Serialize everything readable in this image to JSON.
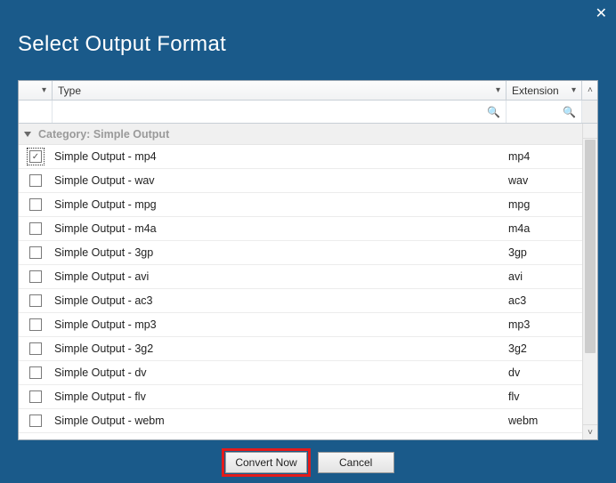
{
  "window": {
    "title": "Select Output Format"
  },
  "columns": {
    "type": "Type",
    "extension": "Extension"
  },
  "group": {
    "prefix": "Category:",
    "name": "Simple Output",
    "full": "Category:  Simple Output"
  },
  "rows": [
    {
      "type": "Simple Output - mp4",
      "ext": "mp4",
      "checked": true,
      "focused": true
    },
    {
      "type": "Simple Output - wav",
      "ext": "wav",
      "checked": false,
      "focused": false
    },
    {
      "type": "Simple Output - mpg",
      "ext": "mpg",
      "checked": false,
      "focused": false
    },
    {
      "type": "Simple Output - m4a",
      "ext": "m4a",
      "checked": false,
      "focused": false
    },
    {
      "type": "Simple Output - 3gp",
      "ext": "3gp",
      "checked": false,
      "focused": false
    },
    {
      "type": "Simple Output - avi",
      "ext": "avi",
      "checked": false,
      "focused": false
    },
    {
      "type": "Simple Output - ac3",
      "ext": "ac3",
      "checked": false,
      "focused": false
    },
    {
      "type": "Simple Output - mp3",
      "ext": "mp3",
      "checked": false,
      "focused": false
    },
    {
      "type": "Simple Output - 3g2",
      "ext": "3g2",
      "checked": false,
      "focused": false
    },
    {
      "type": "Simple Output - dv",
      "ext": "dv",
      "checked": false,
      "focused": false
    },
    {
      "type": "Simple Output - flv",
      "ext": "flv",
      "checked": false,
      "focused": false
    },
    {
      "type": "Simple Output - webm",
      "ext": "webm",
      "checked": false,
      "focused": false
    }
  ],
  "buttons": {
    "convert": "Convert Now",
    "cancel": "Cancel"
  },
  "icons": {
    "close": "✕",
    "dropdown": "▾",
    "search": "🔍",
    "up": "˄",
    "down": "˅",
    "check": "✓"
  }
}
